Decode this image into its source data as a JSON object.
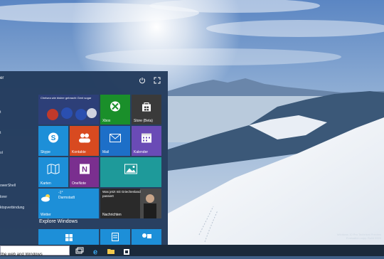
{
  "start_menu": {
    "user": "er",
    "left_items": [
      "t",
      "t",
      "ol",
      "owerShell",
      "lorer",
      "ktopverbindung"
    ],
    "tiles": {
      "news": "Chelsea wie bisher gebracht Gent sogar",
      "xbox": "Xbox",
      "store": "Store (Beta)",
      "skype": "Skype",
      "kontakte": "Kontakte",
      "mail": "Mail",
      "kalender": "Kalender",
      "karten": "Karten",
      "onenote": "OneNote",
      "nachrichten_headline": "Was jetzt mit Griechenland passiert",
      "nachrichten": "Nachrichten",
      "weather_temp": "-1°",
      "weather_city": "Darmstadt",
      "wetter": "Wetter"
    },
    "explore_title": "Explore Windows"
  },
  "taskbar": {
    "search_value": "the web and Windows"
  },
  "watermark": {
    "line1": "Windows 10 Pro Technical Preview",
    "line2": "Evaluation copy. Build 9926"
  },
  "colors": {
    "start_bg": "#223a5c",
    "tile_blue": "#1d8fd8",
    "tile_green": "#1a8f2a",
    "tile_dark": "#3a3a3a",
    "tile_orange": "#d84a20",
    "tile_purple": "#6a4bb6",
    "tile_teal": "#1e9a9a",
    "tile_onenote": "#7a2f8f"
  }
}
